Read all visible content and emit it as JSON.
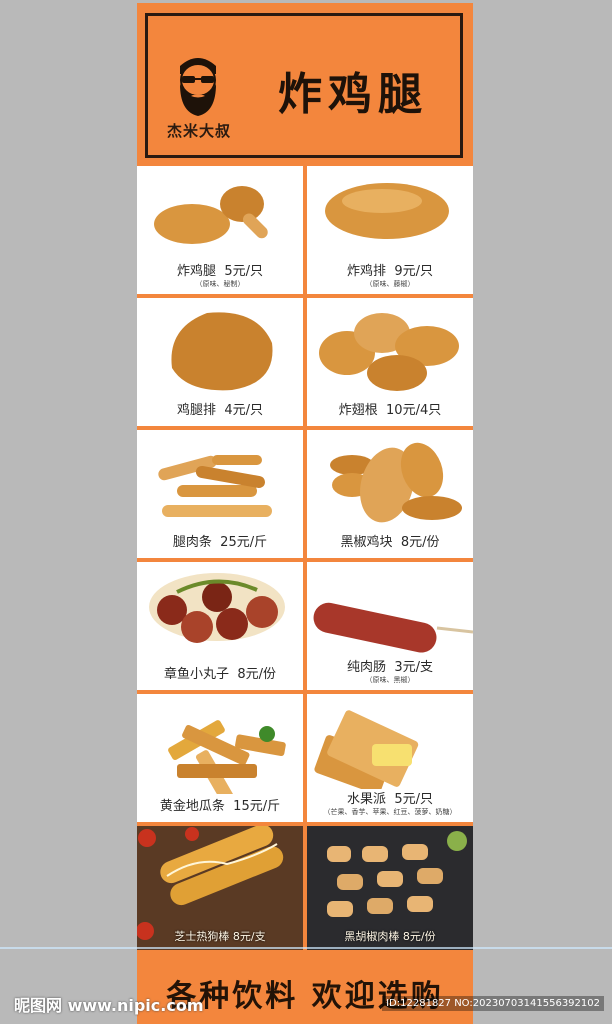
{
  "header": {
    "brand": "杰米大叔",
    "title": "炸鸡腿"
  },
  "items": [
    {
      "name": "炸鸡腿",
      "price": "5元/只",
      "note": "（原味、秘制）"
    },
    {
      "name": "炸鸡排",
      "price": "9元/只",
      "note": "（原味、藤椒）"
    },
    {
      "name": "鸡腿排",
      "price": "4元/只",
      "note": ""
    },
    {
      "name": "炸翅根",
      "price": "10元/4只",
      "note": ""
    },
    {
      "name": "腿肉条",
      "price": "25元/斤",
      "note": ""
    },
    {
      "name": "黑椒鸡块",
      "price": "8元/份",
      "note": ""
    },
    {
      "name": "章鱼小丸子",
      "price": "8元/份",
      "note": ""
    },
    {
      "name": "纯肉肠",
      "price": "3元/支",
      "note": "（原味、黑椒）"
    },
    {
      "name": "黄金地瓜条",
      "price": "15元/斤",
      "note": ""
    },
    {
      "name": "水果派",
      "price": "5元/只",
      "note": "（芒果、香芋、苹果、红豆、菠萝、奶糖）"
    }
  ],
  "photos": [
    {
      "label": "芝士热狗棒 8元/支"
    },
    {
      "label": "黑胡椒肉棒 8元/份"
    }
  ],
  "footer": {
    "text": "各种饮料  欢迎选购"
  },
  "watermark": {
    "left": "昵图网 www.nipic.com",
    "right": "ID:12281827 NO:20230703141556392102"
  },
  "colors": {
    "poster_bg": "#f3863d",
    "page_bg": "#b9b9b9",
    "food": "#d9963f"
  }
}
